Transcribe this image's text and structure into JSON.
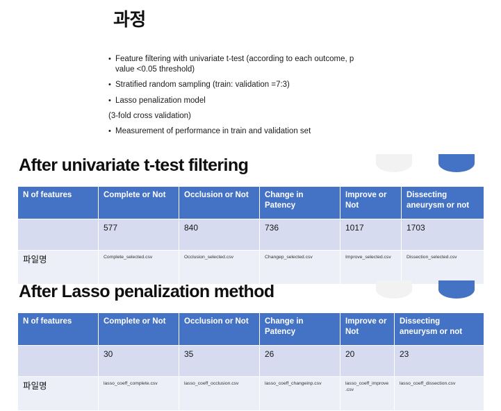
{
  "slide": {
    "title": "과정"
  },
  "bullets": [
    {
      "type": "bullet",
      "text": "Feature filtering with univariate t-test (according to each outcome, p value <0.05 threshold)"
    },
    {
      "type": "bullet",
      "text": "Stratified random sampling (train: validation =7:3)"
    },
    {
      "type": "bullet",
      "text": "Lasso penalization model"
    },
    {
      "type": "plain",
      "text": "(3-fold cross validation)"
    },
    {
      "type": "bullet",
      "text": "Measurement of performance in train and validation set"
    }
  ],
  "bullet_marker": "•",
  "colors": {
    "header_blue": "#4472c4",
    "row_light_blue": "#d6dbf0",
    "row_pale_blue": "#eceef8",
    "deco_gray": "#f2f2f2"
  },
  "sections": [
    {
      "heading": "After univariate t-test filtering",
      "decorations": [
        {
          "name": "semicircle-gray",
          "color": "#f2f2f2"
        },
        {
          "name": "semicircle-blue",
          "color": "#4472c4"
        }
      ],
      "table": {
        "headers": [
          "N of features",
          "Complete or Not",
          "Occlusion or Not",
          "Change in Patency",
          "Improve or Not",
          "Dissecting aneurysm or not"
        ],
        "rows": [
          {
            "name": "count-row",
            "label": "",
            "values": [
              "577",
              "840",
              "736",
              "1017",
              "1703"
            ]
          },
          {
            "name": "file-row",
            "label": "파일명",
            "values": [
              "Complete_selected.csv",
              "Occlusion_selected.csv",
              "Changep_selected.csv",
              "Improve_selected.csv",
              "Dissection_selected.csv"
            ]
          }
        ]
      }
    },
    {
      "heading": "After Lasso penalization method",
      "decorations": [
        {
          "name": "semicircle-gray",
          "color": "#f2f2f2"
        },
        {
          "name": "semicircle-blue",
          "color": "#4472c4"
        }
      ],
      "table": {
        "headers": [
          "N of features",
          "Complete or Not",
          "Occlusion or Not",
          "Change in Patency",
          "Improve or Not",
          "Dissecting aneurysm or not"
        ],
        "rows": [
          {
            "name": "count-row",
            "label": "",
            "values": [
              "30",
              "35",
              "26",
              "20",
              "23"
            ]
          },
          {
            "name": "file-row",
            "label": "파일명",
            "values": [
              "lasso_coeff_complete.csv",
              "lasso_coeff_occlusion.csv",
              "lasso_coeff_changeinp.csv",
              "lasso_coeff_improve.csv",
              "lasso_coeff_dissection.csv"
            ]
          }
        ]
      }
    }
  ]
}
